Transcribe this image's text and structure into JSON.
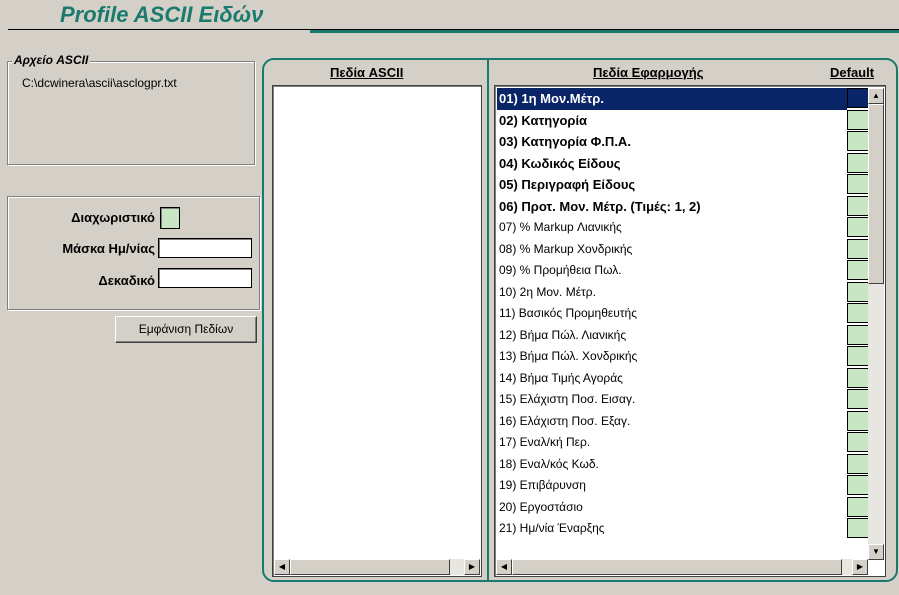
{
  "title": "Profile ASCII Ειδών",
  "ascii_file": {
    "label": "Αρχείο ASCII",
    "path": "C:\\dcwinera\\ascii\\asclogpr.txt"
  },
  "fields": {
    "separator_label": "Διαχωριστικό",
    "date_mask_label": "Μάσκα Ημ/νίας",
    "date_mask_value": "",
    "decimal_label": "Δεκαδικό",
    "decimal_value": "",
    "show_fields_button": "Εμφάνιση Πεδίων"
  },
  "headers": {
    "ascii_fields": "Πεδία ASCII",
    "app_fields": "Πεδία Εφαρμογής",
    "default": "Default"
  },
  "app_fields": [
    {
      "label": "01) 1η Μον.Μέτρ.",
      "bold": true,
      "selected": true
    },
    {
      "label": "02) Κατηγορία",
      "bold": true
    },
    {
      "label": "03) Κατηγορία Φ.Π.Α.",
      "bold": true
    },
    {
      "label": "04) Κωδικός Είδους",
      "bold": true
    },
    {
      "label": "05) Περιγραφή Είδους",
      "bold": true
    },
    {
      "label": "06) Προτ. Μον. Μέτρ. (Τιμές: 1, 2)",
      "bold": true
    },
    {
      "label": "07) % Markup Λιανικής"
    },
    {
      "label": "08) % Markup Χονδρικής"
    },
    {
      "label": "09) % Προμήθεια Πωλ."
    },
    {
      "label": "10) 2η Μον. Μέτρ."
    },
    {
      "label": "11) Βασικός Προμηθευτής"
    },
    {
      "label": "12) Βήμα Πώλ. Λιανικής"
    },
    {
      "label": "13) Βήμα Πώλ. Χονδρικής"
    },
    {
      "label": "14) Βήμα Τιμής Αγοράς"
    },
    {
      "label": "15) Ελάχιστη Ποσ. Εισαγ."
    },
    {
      "label": "16) Ελάχιστη Ποσ. Εξαγ."
    },
    {
      "label": "17) Εναλ/κή Περ."
    },
    {
      "label": "18) Εναλ/κός Κωδ."
    },
    {
      "label": "19) Επιβάρυνση"
    },
    {
      "label": "20) Εργοστάσιο"
    },
    {
      "label": "21) Ημ/νία Έναρξης"
    }
  ],
  "colors": {
    "accent": "#1a7a6e",
    "selection": "#0a2468",
    "default_cell": "#c8e6c4"
  }
}
